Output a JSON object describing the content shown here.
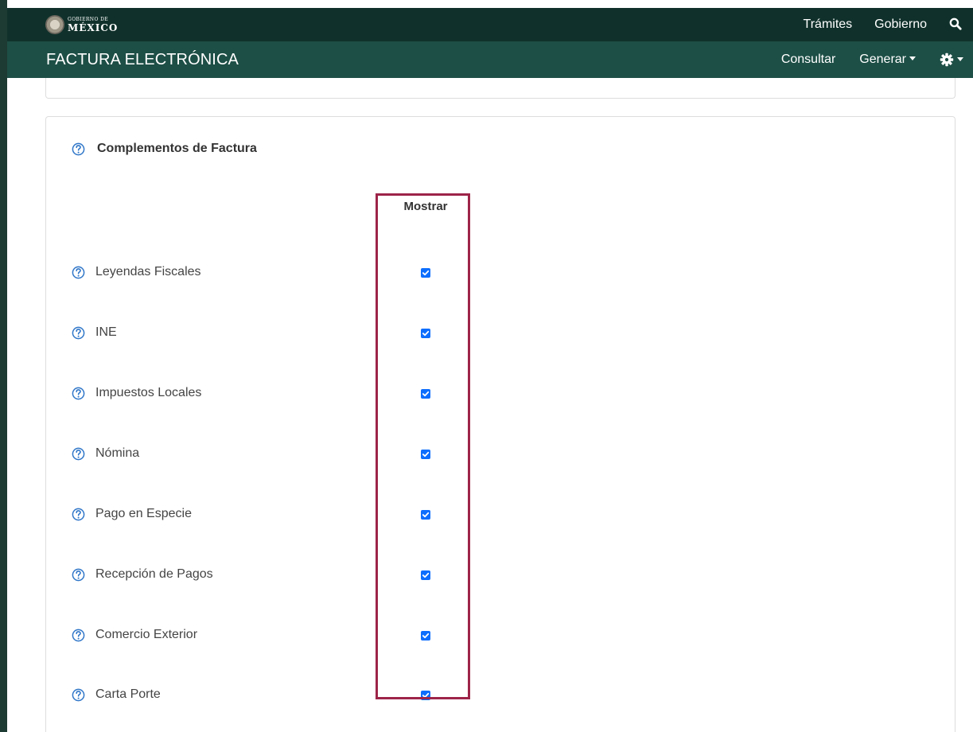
{
  "brand": {
    "line1": "GOBIERNO DE",
    "line2": "MÉXICO"
  },
  "topbar": {
    "links": [
      "Trámites",
      "Gobierno"
    ],
    "search_icon": "search-icon"
  },
  "navbar": {
    "title": "FACTURA ELECTRÓNICA",
    "links": {
      "consultar": "Consultar",
      "generar": "Generar"
    },
    "settings_icon": "gear-icon"
  },
  "panel": {
    "title": "Complementos de Factura",
    "column_header": "Mostrar",
    "items": [
      {
        "label": "Leyendas Fiscales",
        "checked": true
      },
      {
        "label": "INE",
        "checked": true
      },
      {
        "label": "Impuestos Locales",
        "checked": true
      },
      {
        "label": "Nómina",
        "checked": true
      },
      {
        "label": "Pago en Especie",
        "checked": true
      },
      {
        "label": "Recepción de Pagos",
        "checked": true
      },
      {
        "label": "Comercio Exterior",
        "checked": true
      },
      {
        "label": "Carta Porte",
        "checked": true
      }
    ]
  },
  "colors": {
    "topbar": "#10312b",
    "navbar": "#1d4f46",
    "highlight": "#9d2449",
    "checkbox": "#0d6efd",
    "help_icon": "#2f76c8"
  }
}
